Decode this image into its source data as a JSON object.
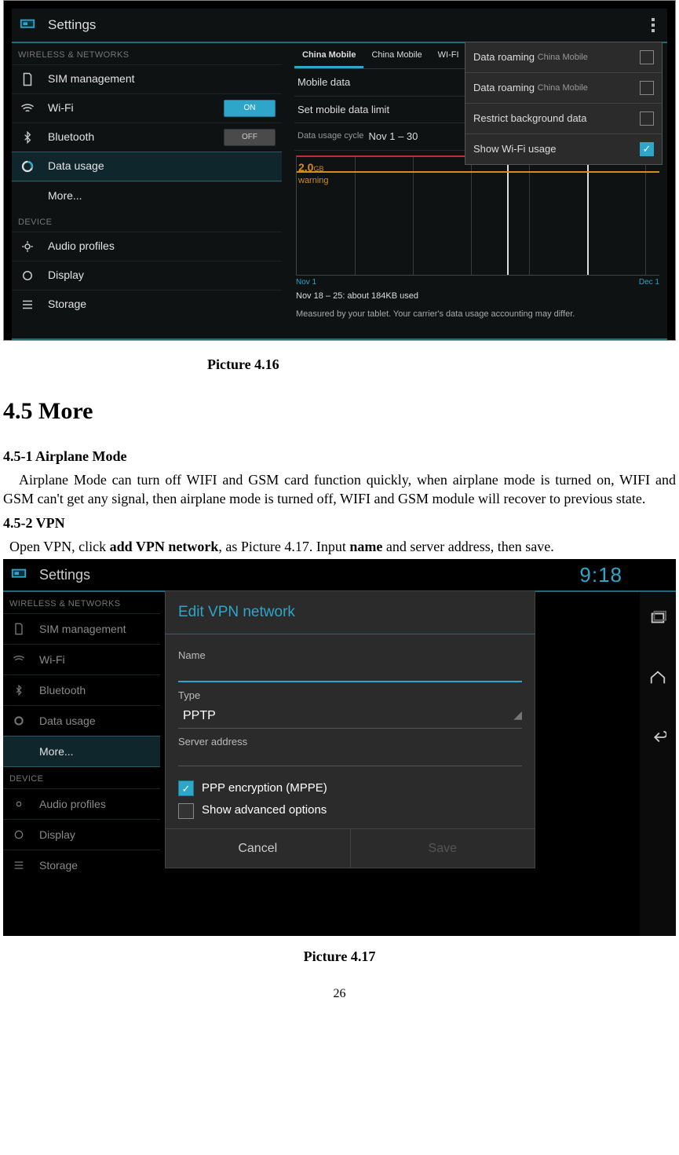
{
  "shot1": {
    "title": "Settings",
    "cat1": "WIRELESS & NETWORKS",
    "sim": "SIM management",
    "wifi": "Wi-Fi",
    "wifi_state": "ON",
    "bt": "Bluetooth",
    "bt_state": "OFF",
    "du": "Data usage",
    "more": "More...",
    "cat2": "DEVICE",
    "audio": "Audio profiles",
    "display": "Display",
    "storage": "Storage",
    "tabs": {
      "t1": "China Mobile",
      "t2": "China Mobile",
      "t3": "WI-FI"
    },
    "mobile_data": "Mobile data",
    "limit": "Set mobile data limit",
    "cycle_lbl": "Data usage cycle",
    "cycle_val": "Nov 1 – 30",
    "warn_val": "2.0",
    "warn_unit": "GB",
    "warn_word": "warning",
    "axis_left": "Nov 1",
    "axis_right": "Dec 1",
    "note1": "Nov 18 – 25: about 184KB used",
    "note2": "Measured by your tablet. Your carrier's data usage accounting may differ.",
    "menu": {
      "r1a": "Data roaming",
      "r1b": "China Mobile",
      "r2a": "Data roaming",
      "r2b": "China Mobile",
      "r3": "Restrict background data",
      "r4": "Show Wi-Fi usage"
    }
  },
  "caption1": "Picture 4.16",
  "h2": "4.5 More",
  "s451": "4.5-1 Airplane Mode",
  "p451": "Airplane Mode can turn off WIFI and GSM card function quickly, when airplane mode is turned on, WIFI and GSM can't get any signal, then airplane mode is turned off, WIFI and GSM module will recover to previous state.",
  "s452": "4.5-2 VPN",
  "p452a": "Open VPN, click ",
  "p452b": "add VPN network",
  "p452c": ", as Picture 4.17. Input ",
  "p452d": "name",
  "p452e": " and server address, then save.",
  "shot2": {
    "title": "Settings",
    "clock": "9:18",
    "cat1": "WIRELESS & NETWORKS",
    "sim": "SIM management",
    "wifi": "Wi-Fi",
    "bt": "Bluetooth",
    "du": "Data usage",
    "more": "More...",
    "cat2": "DEVICE",
    "audio": "Audio profiles",
    "display": "Display",
    "storage": "Storage",
    "dlg": {
      "title": "Edit VPN network",
      "name": "Name",
      "type": "Type",
      "type_val": "PPTP",
      "server": "Server address",
      "ppp": "PPP encryption (MPPE)",
      "adv": "Show advanced options",
      "cancel": "Cancel",
      "save": "Save"
    }
  },
  "caption2": "Picture 4.17",
  "pagenum": "26"
}
